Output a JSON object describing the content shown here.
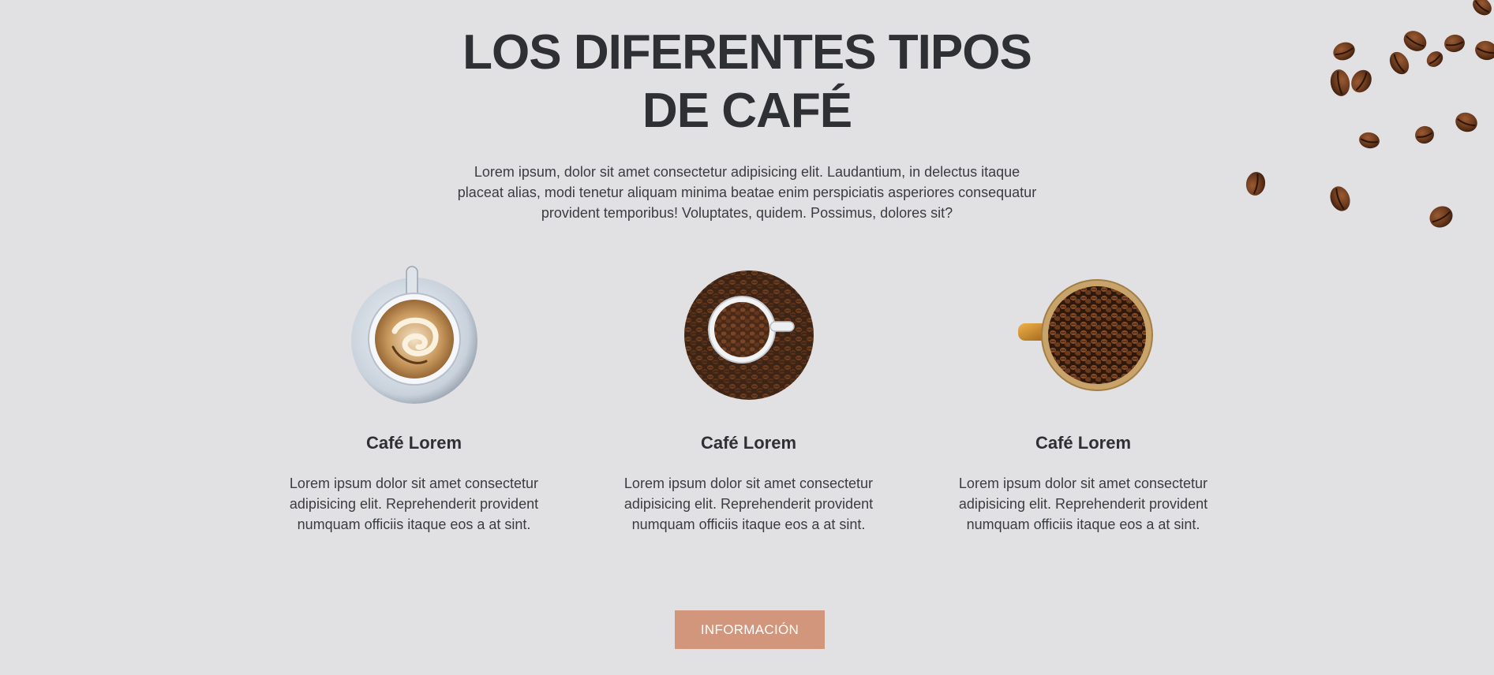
{
  "header": {
    "title": "LOS DIFERENTES TIPOS DE CAFÉ",
    "intro": "Lorem ipsum, dolor sit amet consectetur adipisicing elit. Laudantium, in delectus itaque placeat alias, modi tenetur aliquam minima beatae enim perspiciatis asperiores consequatur provident temporibus! Voluptates, quidem. Possimus, dolores sit?"
  },
  "cards": [
    {
      "title": "Café Lorem",
      "text": "Lorem ipsum dolor sit amet consectetur adipisicing elit. Reprehenderit provident numquam officiis itaque eos a at sint.",
      "image": "latte-art-cup"
    },
    {
      "title": "Café Lorem",
      "text": "Lorem ipsum dolor sit amet consectetur adipisicing elit. Reprehenderit provident numquam officiis itaque eos a at sint.",
      "image": "cup-in-coffee-beans"
    },
    {
      "title": "Café Lorem",
      "text": "Lorem ipsum dolor sit amet consectetur adipisicing elit. Reprehenderit provident numquam officiis itaque eos a at sint.",
      "image": "mug-full-of-beans"
    }
  ],
  "button": {
    "label": "INFORMACIÓN"
  },
  "colors": {
    "background": "#e1e1e4",
    "text": "#2f3033",
    "button": "#d1967b",
    "bean": "#6b3b1f"
  }
}
